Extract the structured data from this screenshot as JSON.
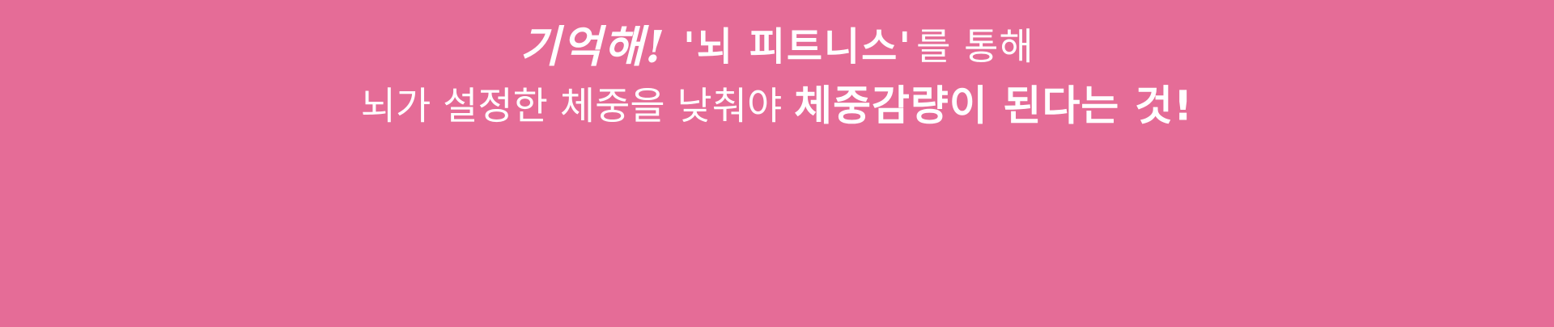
{
  "colors": {
    "background": "#e56c97",
    "text": "#ffffff"
  },
  "headline": {
    "line1": {
      "handwritten": "기억해!",
      "quoted_title": "'뇌 피트니스'",
      "suffix": "를 통해"
    },
    "line2": {
      "plain": "뇌가 설정한 체중을 낮춰야 ",
      "emphasis": "체중감량이 된다는 것!"
    }
  }
}
